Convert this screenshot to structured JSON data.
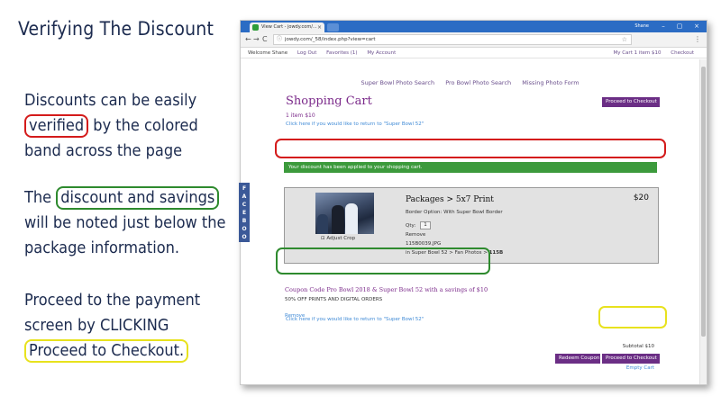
{
  "slide": {
    "title": "Verifying The Discount",
    "p1": {
      "before": "Discounts can be easily ",
      "highlight": "verified",
      "after": " by the colored band across the page"
    },
    "p2": {
      "before": "The ",
      "highlight": "discount and savings",
      "after": " will be noted just below the package information."
    },
    "p3": {
      "before": "Proceed to the payment screen by CLICKING ",
      "highlight": "Proceed to Checkout."
    }
  },
  "browser": {
    "tab_title": "View Cart - jowdy.com/...",
    "tab_close": "×",
    "user": "Shane",
    "window_controls": {
      "minimize": "–",
      "maximize": "▢",
      "close": "×"
    },
    "nav": {
      "back": "←",
      "forward": "→",
      "reload": "C"
    },
    "url": "jowdy.com/_58/index.php?view=cart",
    "url_info_icon": "ⓘ",
    "star_icon": "☆",
    "menu_icon": "⋮"
  },
  "site_nav": {
    "welcome": "Welcome Shane",
    "logout": "Log Out",
    "favorites": "Favorites (1)",
    "account": "My Account",
    "cart": "My Cart 1 item $10",
    "checkout": "Checkout"
  },
  "page": {
    "links": [
      "Super Bowl Photo Search",
      "Pro Bowl Photo Search",
      "Missing Photo Form"
    ],
    "title": "Shopping Cart",
    "proceed_top": "Proceed to Checkout",
    "item_count": "1 item $10",
    "return_link": "Click here if you would like to return to \"Super Bowl 52\"",
    "discount_banner": "Your discount has been applied to your shopping cart."
  },
  "product": {
    "crop_label": "Adjust Crop",
    "crop_icon": "⊡",
    "name": "Packages > 5x7 Print",
    "price": "$20",
    "border_option": "Border Option: With Super Bowl Border",
    "qty_label": "Qty:",
    "qty_value": "1",
    "remove": "Remove",
    "file": "115B0039.JPG",
    "path": "in Super Bowl 52 > Fan Photos > ",
    "path_bold": "115B"
  },
  "coupon": {
    "code": "Coupon Code Pro Bowl 2018 & Super Bowl 52 with a savings of $10",
    "description": "50% OFF PRINTS AND DIGITAL ORDERS",
    "remove": "Remove"
  },
  "footer": {
    "subtotal": "Subtotal $10",
    "redeem": "Redeem Coupon",
    "proceed": "Proceed to Checkout",
    "empty_cart": "Empty Cart"
  },
  "facebook_tab": [
    "F",
    "A",
    "C",
    "E",
    "B",
    "O",
    "O",
    "K"
  ],
  "colors": {
    "accent": "#6b2e85",
    "banner": "#3c9a3c",
    "red_highlight": "#d41b1b",
    "green_highlight": "#2e8a2e",
    "yellow_highlight": "#e8e21e",
    "title_bar": "#2b6cc4"
  }
}
